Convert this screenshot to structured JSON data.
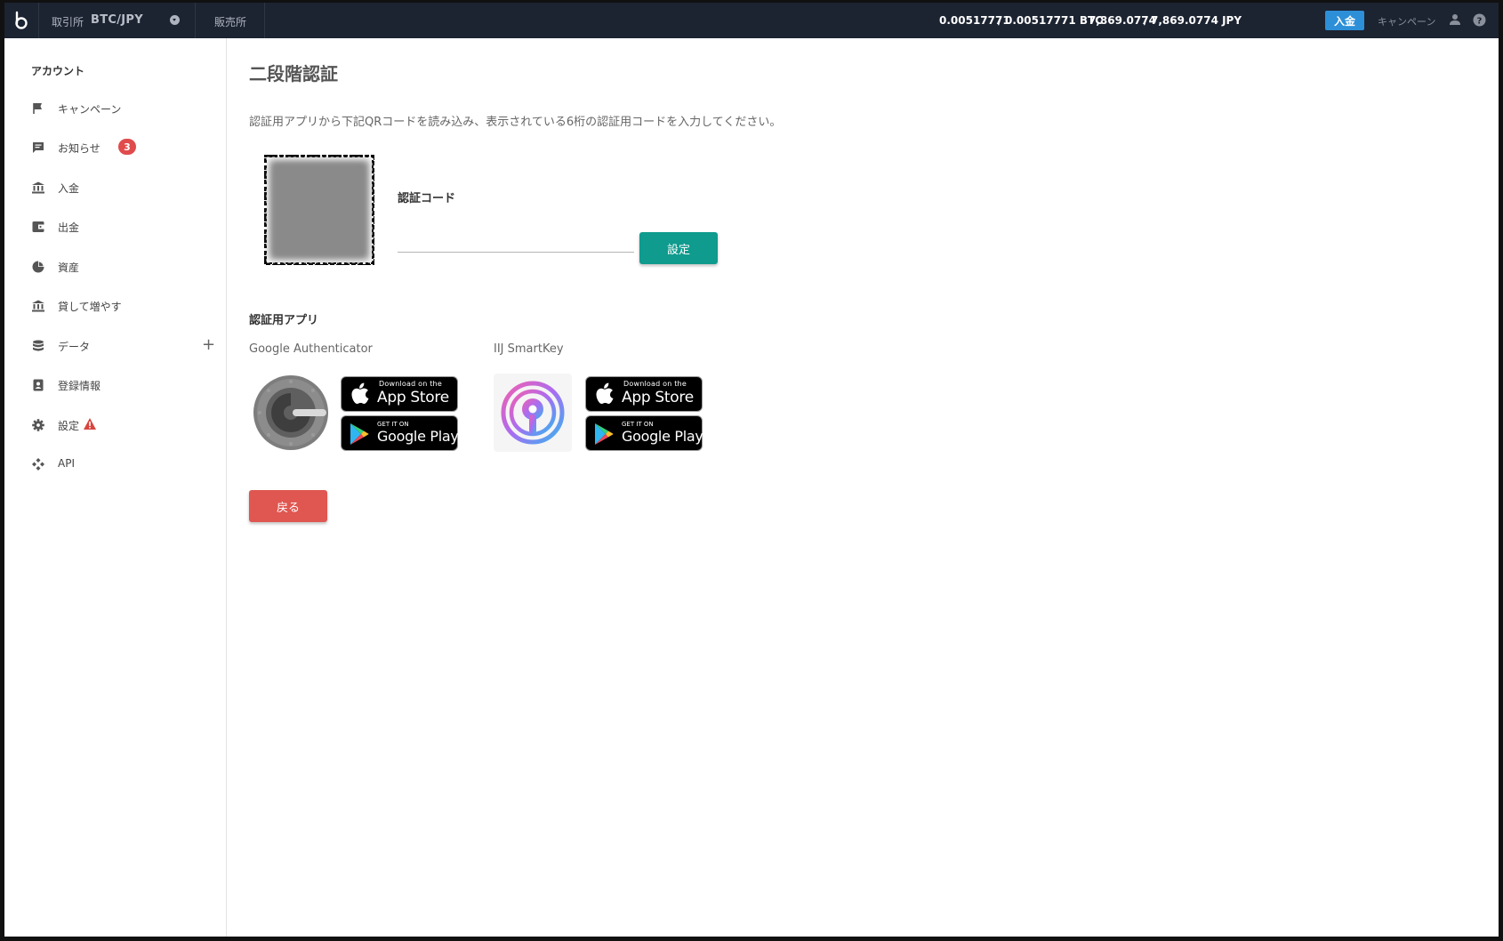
{
  "topbar": {
    "market_label": "取引所",
    "pair": "BTC/JPY",
    "hanbai_label": "販売所",
    "btc_available": "0.00517771",
    "btc_total": "0.00517771 BTC",
    "jpy_available": "7,869.0774",
    "jpy_total": "7,869.0774 JPY",
    "separator": "/",
    "deposit_label": "入金",
    "campaign_label": "キャンペーン"
  },
  "sidebar": {
    "header": "アカウント",
    "items": [
      {
        "label": "キャンペーン",
        "icon": "flag-icon"
      },
      {
        "label": "お知らせ",
        "icon": "message-icon",
        "badge": "3"
      },
      {
        "label": "入金",
        "icon": "bank-icon"
      },
      {
        "label": "出金",
        "icon": "wallet-icon"
      },
      {
        "label": "資産",
        "icon": "pie-chart-icon"
      },
      {
        "label": "貸して増やす",
        "icon": "bank-icon"
      },
      {
        "label": "データ",
        "icon": "database-icon",
        "expand": "+"
      },
      {
        "label": "登録情報",
        "icon": "id-badge-icon"
      },
      {
        "label": "設定",
        "icon": "gear-icon",
        "warning": true
      },
      {
        "label": "API",
        "icon": "api-icon"
      }
    ]
  },
  "main": {
    "title": "二段階認証",
    "description": "認証用アプリから下記QRコードを読み込み、表示されている6桁の認証用コードを入力してください。",
    "code_label": "認証コード",
    "code_value": "",
    "set_button": "設定",
    "apps_header": "認証用アプリ",
    "apps": [
      {
        "name": "Google Authenticator",
        "app_store_small": "Download on the",
        "app_store_big": "App Store",
        "google_play_small": "GET IT ON",
        "google_play_big": "Google Play"
      },
      {
        "name": "IIJ SmartKey",
        "app_store_small": "Download on the",
        "app_store_big": "App Store",
        "google_play_small": "GET IT ON",
        "google_play_big": "Google Play"
      }
    ],
    "back_button": "戻る"
  },
  "colors": {
    "topbar_bg": "#1c2331",
    "deposit_btn": "#2d8fd8",
    "set_btn": "#0f9b8e",
    "back_btn": "#e05650",
    "badge": "#e04b4b"
  }
}
